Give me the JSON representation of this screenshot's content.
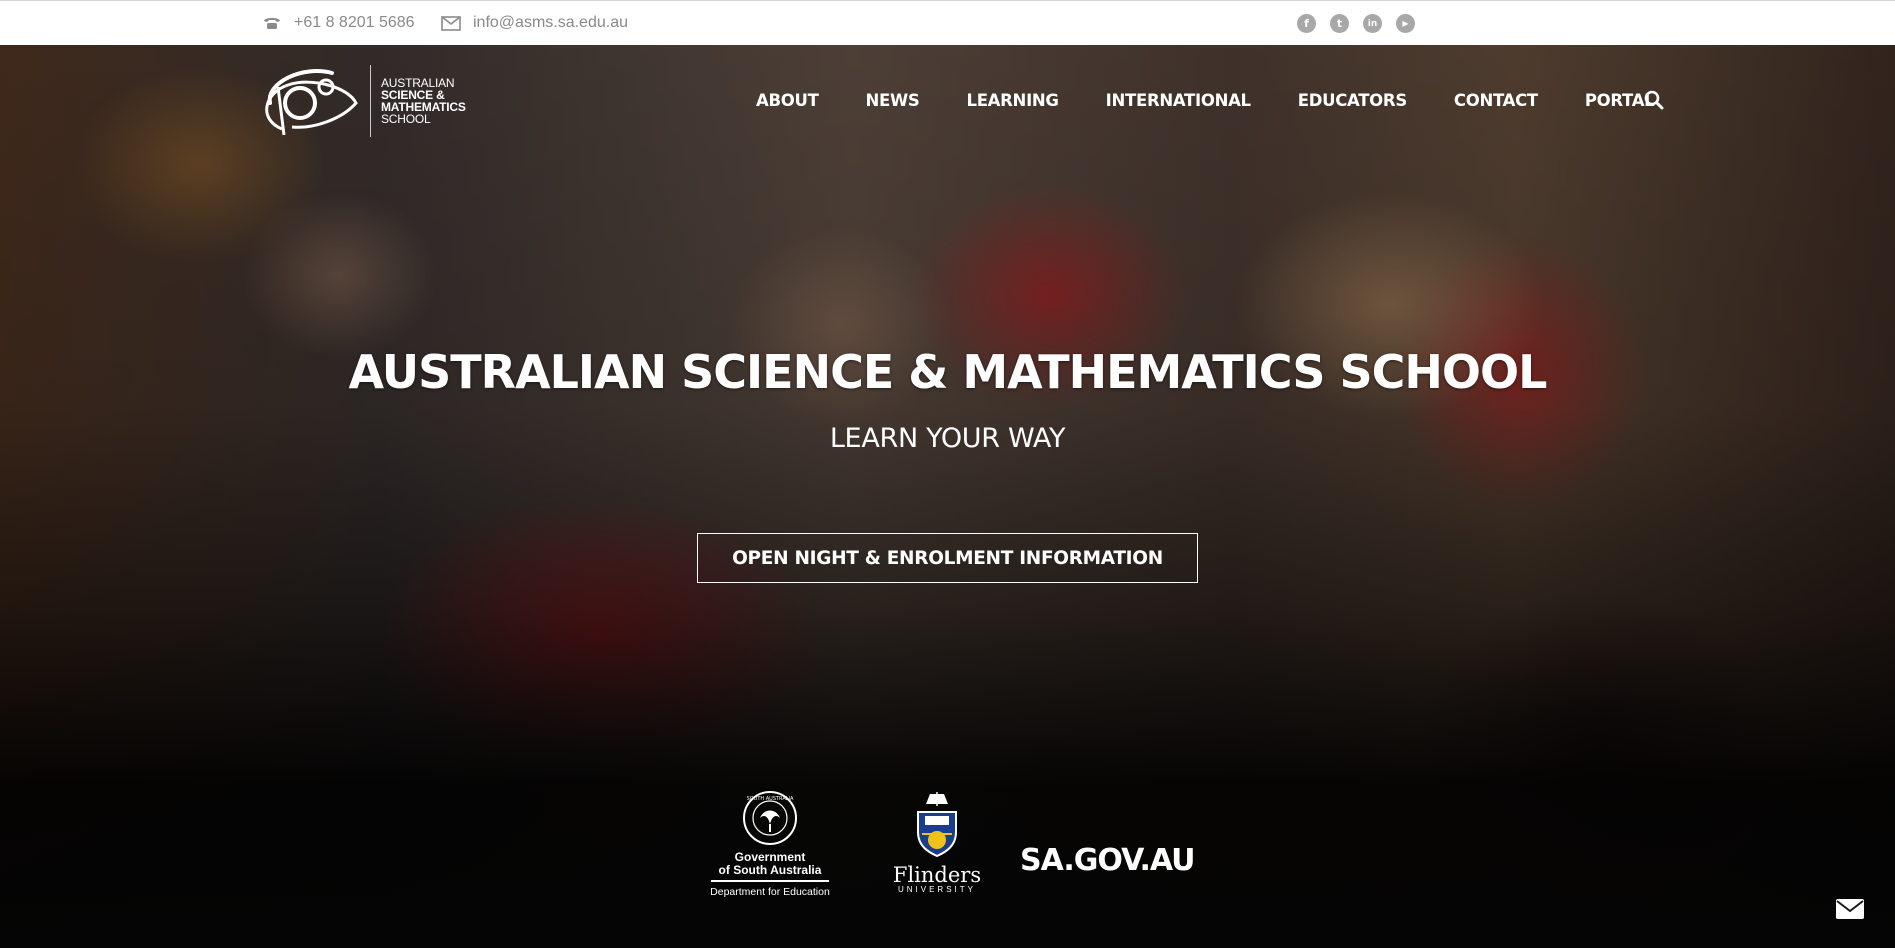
{
  "topbar": {
    "phone": "+61 8 8201 5686",
    "email": "info@asms.sa.edu.au",
    "social": [
      {
        "name": "facebook-icon",
        "glyph": "f"
      },
      {
        "name": "twitter-icon",
        "glyph": "t"
      },
      {
        "name": "linkedin-icon",
        "glyph": "in"
      },
      {
        "name": "youtube-icon",
        "glyph": "▶"
      }
    ]
  },
  "logo": {
    "lines": [
      "AUSTRALIAN",
      "SCIENCE &",
      "MATHEMATICS",
      "SCHOOL"
    ]
  },
  "nav": {
    "items": [
      "ABOUT",
      "NEWS",
      "LEARNING",
      "INTERNATIONAL",
      "EDUCATORS",
      "CONTACT",
      "PORTAL"
    ]
  },
  "hero": {
    "title": "AUSTRALIAN SCIENCE & MATHEMATICS SCHOOL",
    "subtitle": "LEARN YOUR WAY",
    "cta_label": "OPEN NIGHT & ENROLMENT INFORMATION"
  },
  "partners": {
    "gov_seal_text": "SOUTH AUSTRALIA",
    "gov_line1": "Government",
    "gov_line2": "of South Australia",
    "gov_line3": "Department for Education",
    "flinders_name": "Flinders",
    "flinders_sub": "UNIVERSITY",
    "sagov": "SA.GOV.AU"
  },
  "colors": {
    "topbar_bg": "#ffffff",
    "topbar_text": "#8a8a8a",
    "hero_text": "#ffffff"
  }
}
